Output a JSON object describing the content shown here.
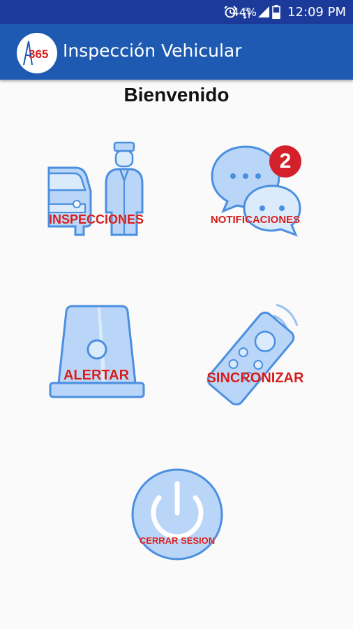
{
  "status_bar": {
    "battery_percent": "44%",
    "time": "12:09 PM",
    "icons": [
      "alarm-icon",
      "data-icon",
      "signal-icon",
      "battery-icon"
    ]
  },
  "app_bar": {
    "logo_text": "365",
    "title": "Inspección Vehicular"
  },
  "main": {
    "welcome": "Bienvenido",
    "tiles": [
      {
        "label": "INSPECCIONES",
        "icon": "car-inspector-icon"
      },
      {
        "label": "NOTIFICACIONES",
        "icon": "chat-bubbles-icon",
        "badge": "2"
      },
      {
        "label": "ALERTAR",
        "icon": "siren-light-icon"
      },
      {
        "label": "SINCRONIZAR",
        "icon": "remote-control-icon"
      },
      {
        "label": "CERRAR SESION",
        "icon": "power-icon"
      }
    ]
  },
  "colors": {
    "status_bar": "#1c3a9a",
    "app_bar": "#1e5ab1",
    "label_red": "#d41c1c",
    "icon_fill": "#b9d5f7",
    "icon_stroke": "#4a8fe0",
    "badge": "#d4202a"
  }
}
